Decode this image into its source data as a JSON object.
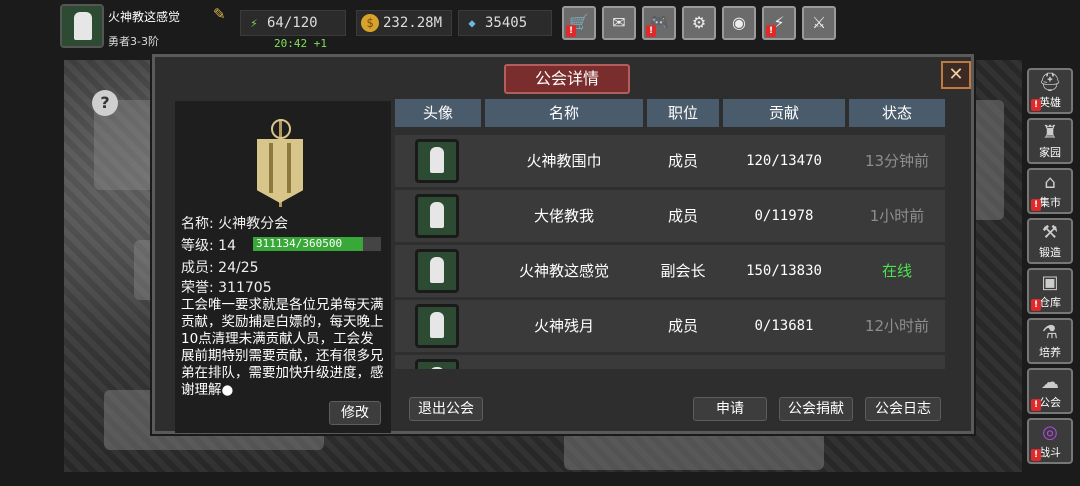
{
  "player": {
    "name": "火神教这感觉",
    "rank": "勇者3-3阶"
  },
  "resources": {
    "energy": "64/120",
    "energy_timer": "20:42 +1",
    "gold": "232.28M",
    "gems": "35405"
  },
  "top_buttons": [
    "shop-cart-icon",
    "mail-icon",
    "gamepad-icon",
    "gear-icon",
    "color-wheel-icon",
    "lightning-icon",
    "swords-icon"
  ],
  "sidebar": {
    "items": [
      {
        "label": "英雄",
        "icon": "hero-helmet-icon",
        "alert": true
      },
      {
        "label": "家园",
        "icon": "castle-icon",
        "alert": false
      },
      {
        "label": "集市",
        "icon": "market-icon",
        "alert": true
      },
      {
        "label": "锻造",
        "icon": "anvil-icon",
        "alert": false
      },
      {
        "label": "仓库",
        "icon": "chest-icon",
        "alert": true
      },
      {
        "label": "培养",
        "icon": "potion-icon",
        "alert": false
      },
      {
        "label": "公会",
        "icon": "guild-sheep-icon",
        "alert": true
      },
      {
        "label": "战斗",
        "icon": "portal-icon",
        "alert": true
      }
    ]
  },
  "dialog": {
    "title": "公会详情",
    "guild": {
      "name_label": "名称:",
      "name": "火神教分会",
      "level_label": "等级:",
      "level": "14",
      "xp": "311134/360500",
      "xp_fraction": 0.863,
      "members_label": "成员:",
      "members": "24/25",
      "honor_label": "荣誉:",
      "honor": "311705",
      "description": "工会唯一要求就是各位兄弟每天满贡献，奖励捕是白嫖的，每天晚上10点清理未满贡献人员，工会发展前期特别需要贡献，还有很多兄弟在排队，需要加快升级进度，感谢理解●"
    },
    "buttons": {
      "edit": "修改",
      "leave": "退出公会",
      "apply": "申请",
      "donate": "公会捐献",
      "log": "公会日志"
    },
    "table": {
      "headers": [
        "头像",
        "名称",
        "职位",
        "贡献",
        "状态"
      ],
      "rows": [
        {
          "name": "火神教围巾",
          "role": "成员",
          "contribution": "120/13470",
          "status": "13分钟前",
          "online": false
        },
        {
          "name": "大佬教我",
          "role": "成员",
          "contribution": "0/11978",
          "status": "1小时前",
          "online": false
        },
        {
          "name": "火神教这感觉",
          "role": "副会长",
          "contribution": "150/13830",
          "status": "在线",
          "online": true
        },
        {
          "name": "火神残月",
          "role": "成员",
          "contribution": "0/13681",
          "status": "12小时前",
          "online": false
        }
      ]
    }
  }
}
